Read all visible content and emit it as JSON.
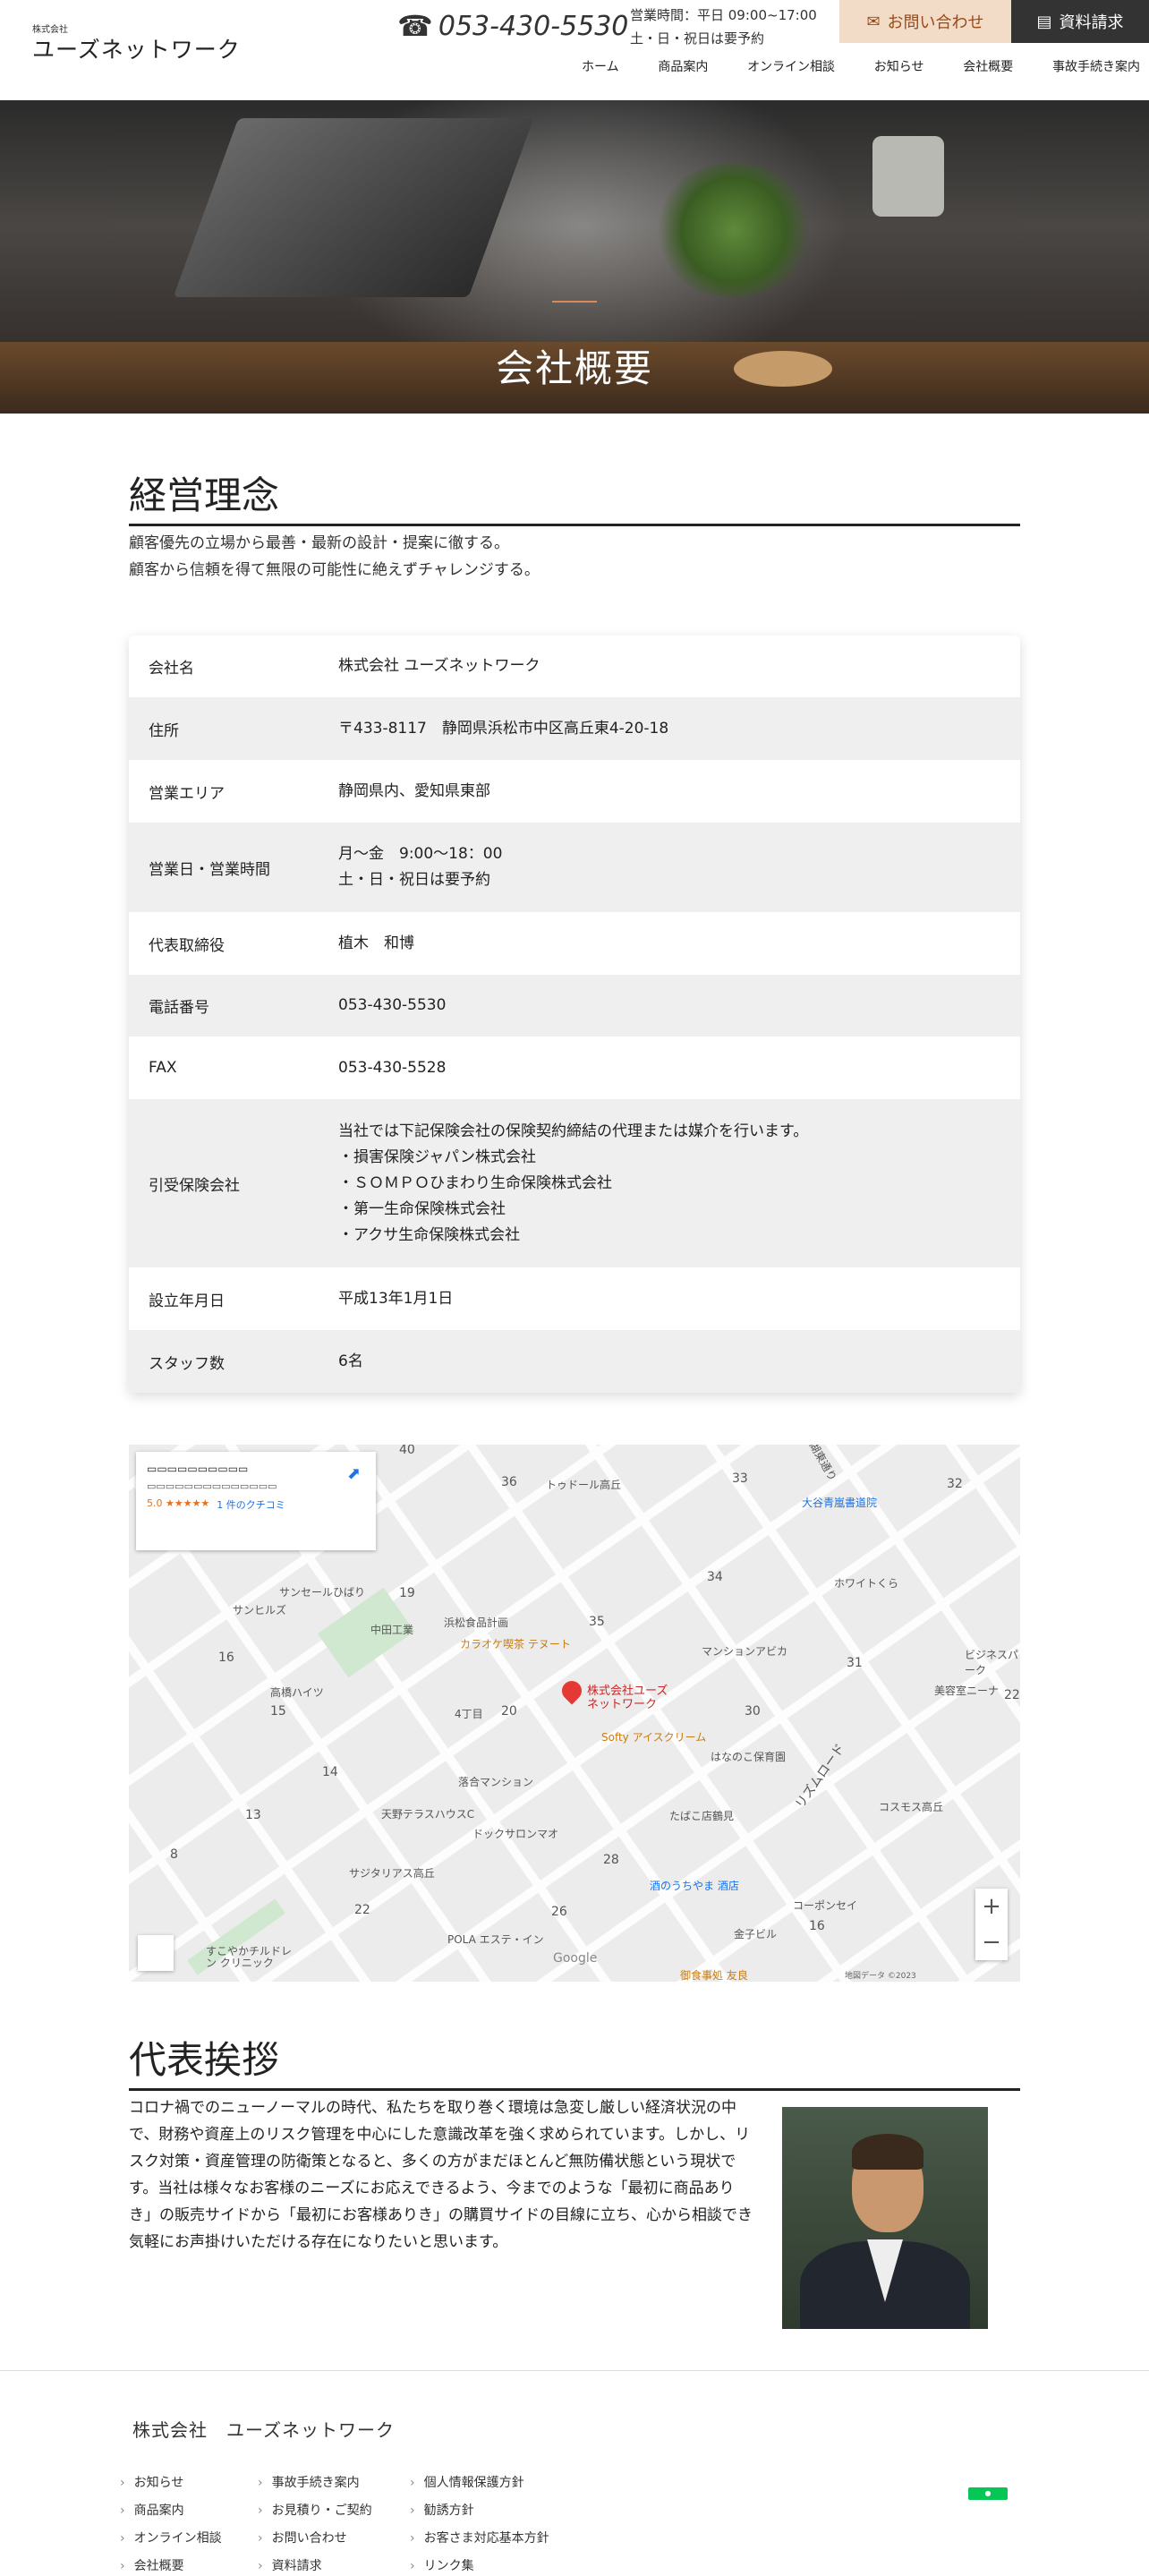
{
  "header": {
    "logo_small": "株式会社",
    "logo_main": "ユーズネットワーク",
    "phone": "053-430-5530",
    "hours_line1": "営業時間：平日 09:00~17:00",
    "hours_line2": "土・日・祝日は要予約",
    "contact_label": "お問い合わせ",
    "docs_label": "資料請求",
    "nav": [
      "ホーム",
      "商品案内",
      "オンライン相談",
      "お知らせ",
      "会社概要",
      "事故手続き案内"
    ]
  },
  "hero": {
    "title": "会社概要"
  },
  "philosophy": {
    "heading": "経営理念",
    "line1": "顧客優先の立場から最善・最新の設計・提案に徹する。",
    "line2": "顧客から信頼を得て無限の可能性に絶えずチャレンジする。"
  },
  "company_table": [
    {
      "label": "会社名",
      "value": [
        "株式会社 ユーズネットワーク"
      ]
    },
    {
      "label": "住所",
      "value": [
        "〒433-8117　静岡県浜松市中区高丘東4-20-18"
      ]
    },
    {
      "label": "営業エリア",
      "value": [
        "静岡県内、愛知県東部"
      ]
    },
    {
      "label": "営業日・営業時間",
      "value": [
        "月～金　9:00～18：00",
        "土・日・祝日は要予約"
      ]
    },
    {
      "label": "代表取締役",
      "value": [
        "植木　和博"
      ]
    },
    {
      "label": "電話番号",
      "value": [
        "053-430-5530"
      ]
    },
    {
      "label": "FAX",
      "value": [
        "053-430-5528"
      ]
    },
    {
      "label": "引受保険会社",
      "value": [
        "当社では下記保険会社の保険契約締結の代理または媒介を行います。",
        "・損害保険ジャパン株式会社",
        "・ＳＯＭＰＯひまわり生命保険株式会社",
        "・第一生命保険株式会社",
        "・アクサ生命保険株式会社"
      ]
    },
    {
      "label": "設立年月日",
      "value": [
        "平成13年1月1日"
      ]
    },
    {
      "label": "スタッフ数",
      "value": [
        "6名"
      ]
    }
  ],
  "map": {
    "pin_label_1": "株式会社ユーズ",
    "pin_label_2": "ネットワーク",
    "rating": "5.0 ★★★★★",
    "reviews": "1 件のクチコミ",
    "zoom_in": "+",
    "zoom_out": "−",
    "google": "Google",
    "copyright": "地図データ ©2023",
    "places": [
      "浜松食品計画",
      "カラオケ喫茶 テヌート",
      "Softy アイスクリーム",
      "マンションアビカ",
      "大谷青嵐書道院",
      "ホワイトくら",
      "リズムロード",
      "湖東通り",
      "4丁目",
      "サンセールひばり",
      "サンヒルズ",
      "高橋ハイツ",
      "落合マンション",
      "天野テラスハウスC",
      "ドックサロンマオ",
      "たばこ店鶴見",
      "コスモス高丘",
      "サジタリアス高丘",
      "酒のうちやま 酒店",
      "コーポンセイ",
      "金子ビル",
      "御食事処 友良",
      "POLA エステ・イン",
      "すこやかチルドレン クリニック",
      "ビジネスパーク",
      "美容室ニーナ",
      "はなのこ保育園",
      "トゥドール高丘",
      "中田工業"
    ],
    "numbers": [
      "40",
      "36",
      "33",
      "32",
      "19",
      "35",
      "34",
      "31",
      "16",
      "15",
      "20",
      "30",
      "22",
      "14",
      "13",
      "8",
      "28",
      "26",
      "16",
      "22"
    ]
  },
  "greeting": {
    "heading": "代表挨拶",
    "text": "コロナ禍でのニューノーマルの時代、私たちを取り巻く環境は急変し厳しい経済状況の中で、財務や資産上のリスク管理を中心にした意識改革を強く求められています。しかし、リスク対策・資産管理の防衛策となると、多くの方がまだほとんど無防備状態という現状です。当社は様々なお客様のニーズにお応えできるよう、今までのような「最初に商品ありき」の販売サイドから「最初にお客様ありき」の購買サイドの目線に立ち、心から相談でき気軽にお声掛けいただける存在になりたいと思います。"
  },
  "footer": {
    "company": "株式会社　ユーズネットワーク",
    "col1": [
      "お知らせ",
      "商品案内",
      "オンライン相談",
      "会社概要"
    ],
    "col2": [
      "事故手続き案内",
      "お見積り・ご契約",
      "お問い合わせ",
      "資料請求"
    ],
    "col3": [
      "個人情報保護方針",
      "勧誘方針",
      "お客さま対応基本方針",
      "リンク集"
    ]
  }
}
